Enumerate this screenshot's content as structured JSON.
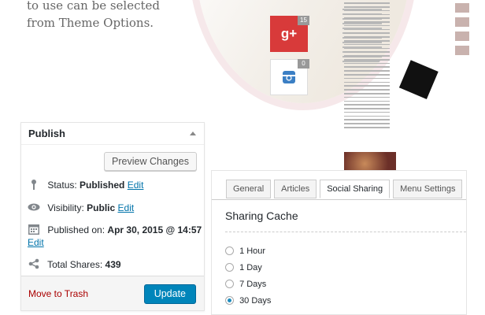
{
  "promo": {
    "line1": "to use can be selected",
    "line2": "from Theme Options."
  },
  "share": {
    "gplus_label": "g+",
    "gplus_count": "15",
    "instagram_count": "0"
  },
  "publish": {
    "title": "Publish",
    "preview_label": "Preview Changes",
    "status_label": "Status:",
    "status_value": "Published",
    "visibility_label": "Visibility:",
    "visibility_value": "Public",
    "published_on_label": "Published on:",
    "published_on_value": "Apr 30, 2015 @ 14:57",
    "edit_label": "Edit",
    "total_shares_label": "Total Shares:",
    "total_shares_value": "439",
    "trash_label": "Move to Trash",
    "update_label": "Update"
  },
  "settings": {
    "tabs": [
      {
        "label": "General"
      },
      {
        "label": "Articles"
      },
      {
        "label": "Social Sharing"
      },
      {
        "label": "Menu Settings"
      }
    ],
    "active_tab": "Social Sharing",
    "section_title": "Sharing Cache",
    "options": [
      {
        "label": "1 Hour",
        "selected": false
      },
      {
        "label": "1 Day",
        "selected": false
      },
      {
        "label": "7 Days",
        "selected": false
      },
      {
        "label": "30 Days",
        "selected": true
      }
    ]
  },
  "colors": {
    "link": "#0073aa",
    "primary_button": "#0085ba",
    "trash": "#a00000",
    "gplus": "#d83a3a"
  }
}
